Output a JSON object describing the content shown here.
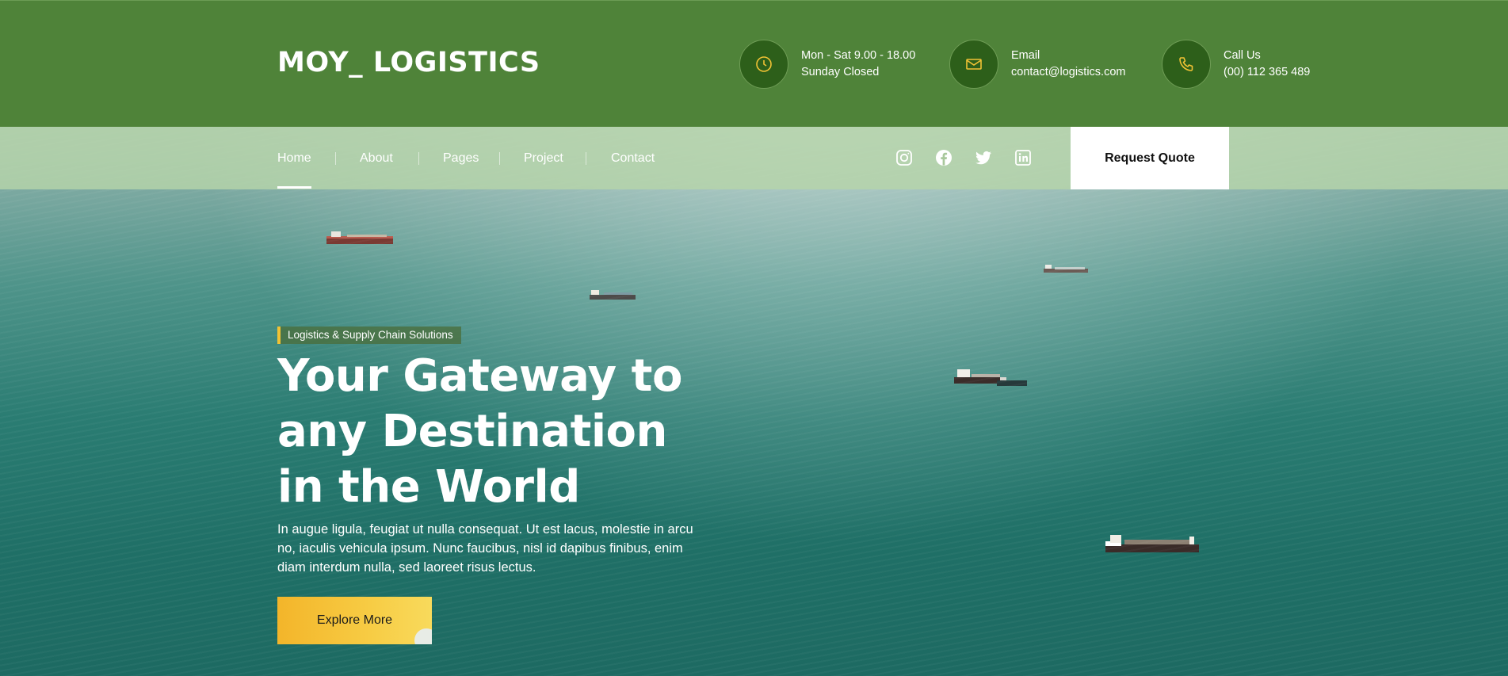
{
  "header": {
    "logo": "MOY_ LOGISTICS",
    "hours": {
      "line1": "Mon - Sat 9.00 - 18.00",
      "line2": "Sunday Closed",
      "icon": "clock-icon"
    },
    "email": {
      "label": "Email",
      "value": "contact@logistics.com",
      "icon": "mail-icon"
    },
    "call": {
      "label": "Call Us",
      "value": "(00) 112 365 489",
      "icon": "phone-icon"
    }
  },
  "nav": {
    "items": [
      {
        "label": "Home",
        "active": true
      },
      {
        "label": "About"
      },
      {
        "label": "Pages"
      },
      {
        "label": "Project"
      },
      {
        "label": "Contact"
      }
    ],
    "social": [
      "instagram-icon",
      "facebook-icon",
      "twitter-icon",
      "linkedin-icon"
    ],
    "quote_button": "Request Quote"
  },
  "hero": {
    "tagline": "Logistics & Supply Chain Solutions",
    "title_lines": [
      "Your Gateway to",
      "any Destination",
      "in the World"
    ],
    "description": "In augue ligula, feugiat ut nulla consequat. Ut est lacus, molestie in arcu no, iaculis vehicula ipsum. Nunc faucibus, nisl id dapibus finibus, enim diam interdum nulla, sed laoreet risus lectus.",
    "button": "Explore More"
  },
  "colors": {
    "header_green": "#4f8339",
    "icon_circle": "#2d5f1a",
    "accent_yellow": "#f1c234",
    "ocean": "#2a7b72"
  }
}
